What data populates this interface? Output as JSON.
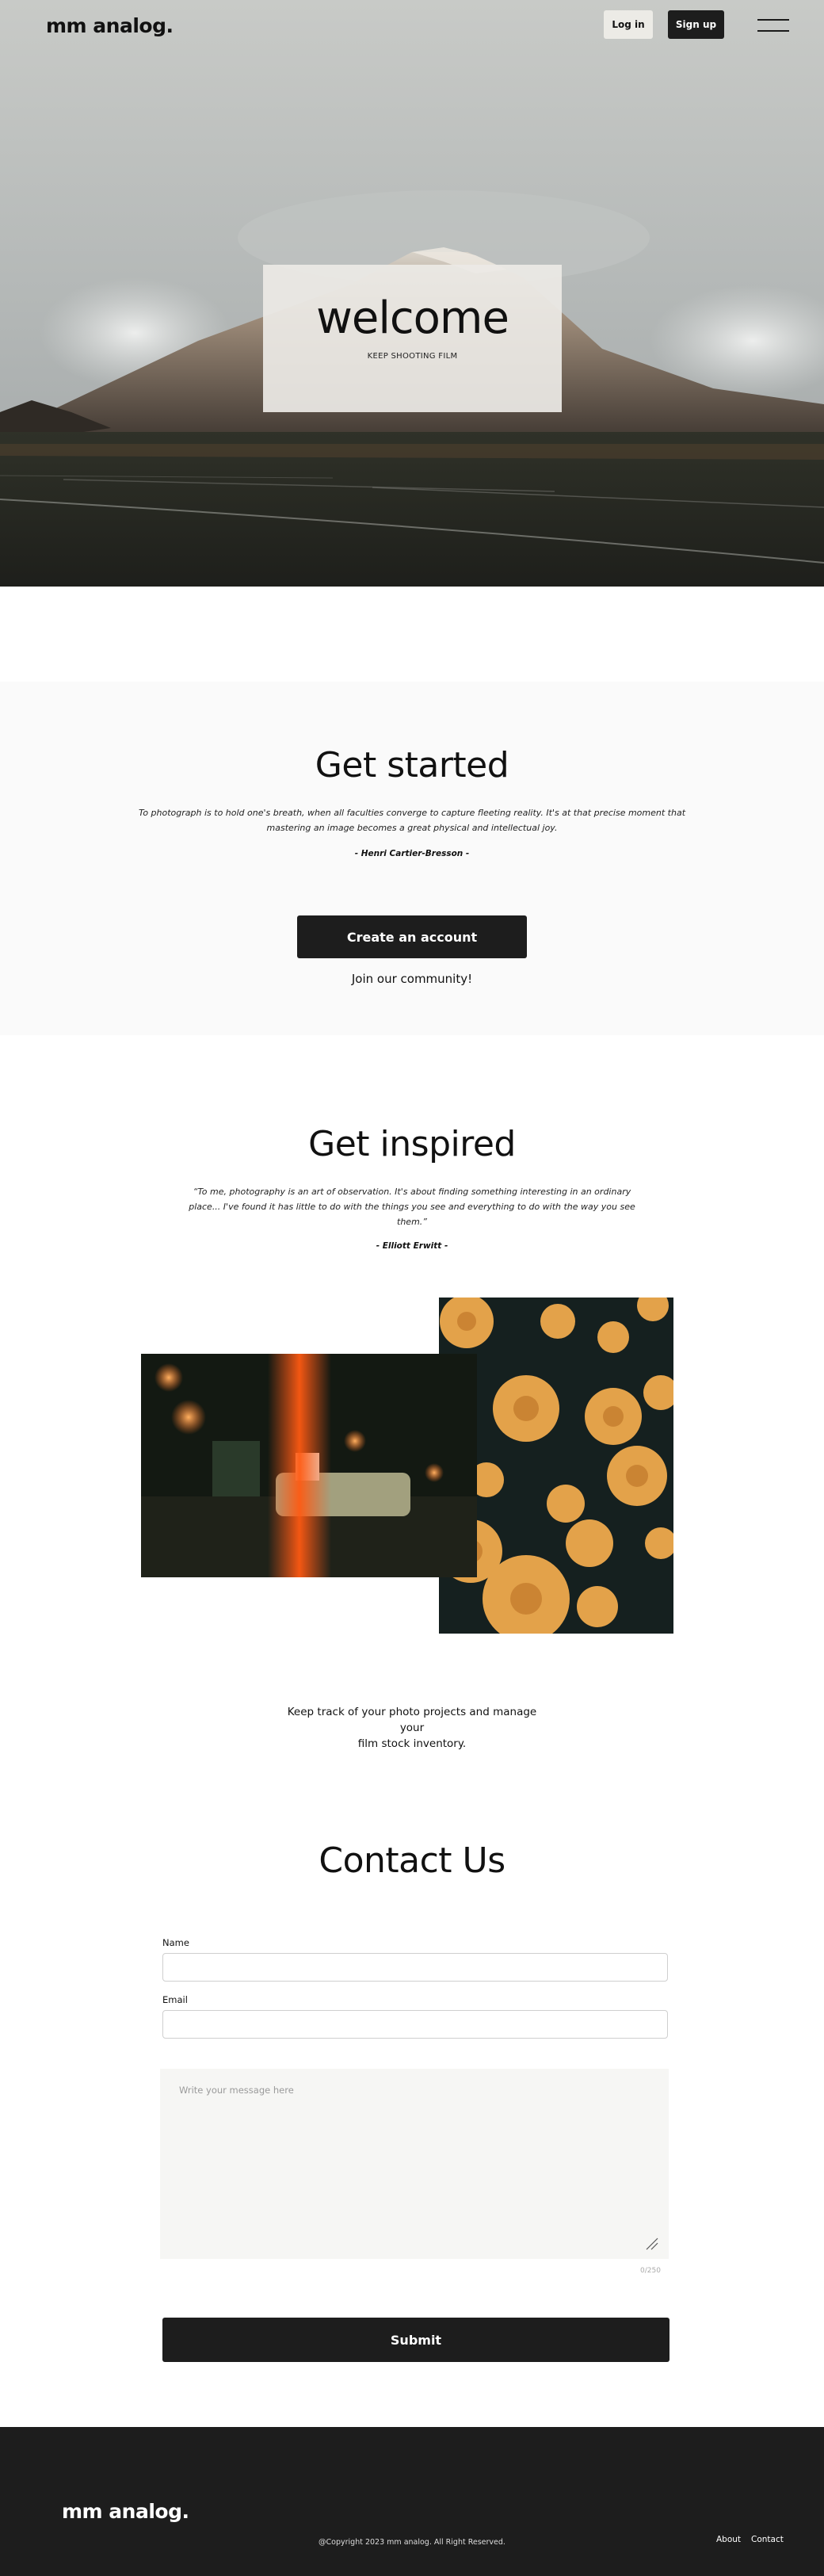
{
  "header": {
    "logo": "mm analog.",
    "login_label": "Log in",
    "signup_label": "Sign up"
  },
  "hero": {
    "title": "welcome",
    "subtitle": "KEEP SHOOTING FILM"
  },
  "get_started": {
    "title": "Get started",
    "quote_line1": "To photograph is to hold one's breath, when all faculties converge to capture fleeting reality. It's at that precise moment that",
    "quote_line2": "mastering an image becomes a great physical and intellectual joy.",
    "attribution": "- Henri Cartier-Bresson -",
    "button_label": "Create an account",
    "join_text": "Join our community!"
  },
  "get_inspired": {
    "title": "Get inspired",
    "quote_line1": "“To me, photography is an art of observation. It's about finding something interesting in an ordinary",
    "quote_line2": "place... I've found it has little to do with the things you see and everything to do with the way you see",
    "quote_line3": "them.”",
    "attribution": "- Elliott Erwitt -",
    "track_line1": "Keep track of your photo projects and manage your",
    "track_line2": "film stock inventory."
  },
  "contact": {
    "title": "Contact Us",
    "name_label": "Name",
    "name_value": "",
    "email_label": "Email",
    "email_value": "",
    "message_placeholder": "Write your message here",
    "counter": "0/250",
    "submit_label": "Submit"
  },
  "footer": {
    "logo": "mm analog.",
    "copyright": "@Copyright 2023 mm analog. All Right Reserved.",
    "about_label": "About",
    "contact_label": "Contact"
  },
  "icons": {
    "menu": "hamburger-menu-icon",
    "resize": "resize-grip-icon"
  },
  "colors": {
    "dark": "#1d1d1d",
    "light_button": "#ecebe6",
    "section_bg": "#fafafa"
  }
}
